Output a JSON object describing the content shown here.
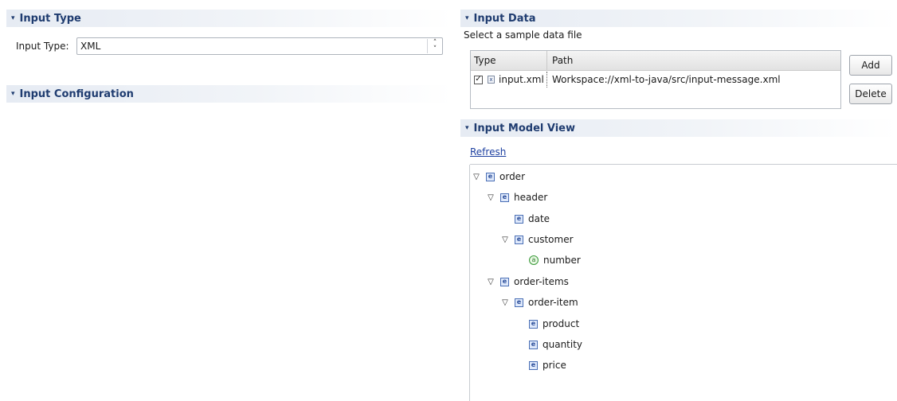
{
  "left": {
    "input_type_section": {
      "title": "Input Type"
    },
    "input_type_label": "Input Type:",
    "input_type_value": "XML",
    "input_config_section": {
      "title": "Input Configuration"
    }
  },
  "right": {
    "input_data_section": {
      "title": "Input Data"
    },
    "sample_hint": "Select a sample data file",
    "table": {
      "columns": [
        "Type",
        "Path"
      ],
      "rows": [
        {
          "checked": true,
          "type": "input.xml",
          "path": "Workspace://xml-to-java/src/input-message.xml"
        }
      ]
    },
    "add_label": "Add",
    "delete_label": "Delete",
    "model_view_section": {
      "title": "Input Model View"
    },
    "refresh_label": "Refresh",
    "tree": [
      {
        "label": "order",
        "kind": "element",
        "expanded": true
      },
      {
        "label": "header",
        "kind": "element",
        "expanded": true
      },
      {
        "label": "date",
        "kind": "element"
      },
      {
        "label": "customer",
        "kind": "element",
        "expanded": true
      },
      {
        "label": "number",
        "kind": "attribute"
      },
      {
        "label": "order-items",
        "kind": "element",
        "expanded": true
      },
      {
        "label": "order-item",
        "kind": "element",
        "expanded": true
      },
      {
        "label": "product",
        "kind": "element"
      },
      {
        "label": "quantity",
        "kind": "element"
      },
      {
        "label": "price",
        "kind": "element"
      }
    ]
  },
  "icons": {
    "twisty_expanded": "▾",
    "tree_expanded": "▽",
    "element_glyph": "e",
    "attribute_glyph": "a",
    "xml_file_glyph": "x",
    "check_glyph": "✓"
  },
  "colors": {
    "section_title": "#1f3c70",
    "link": "#1c3fa0"
  }
}
